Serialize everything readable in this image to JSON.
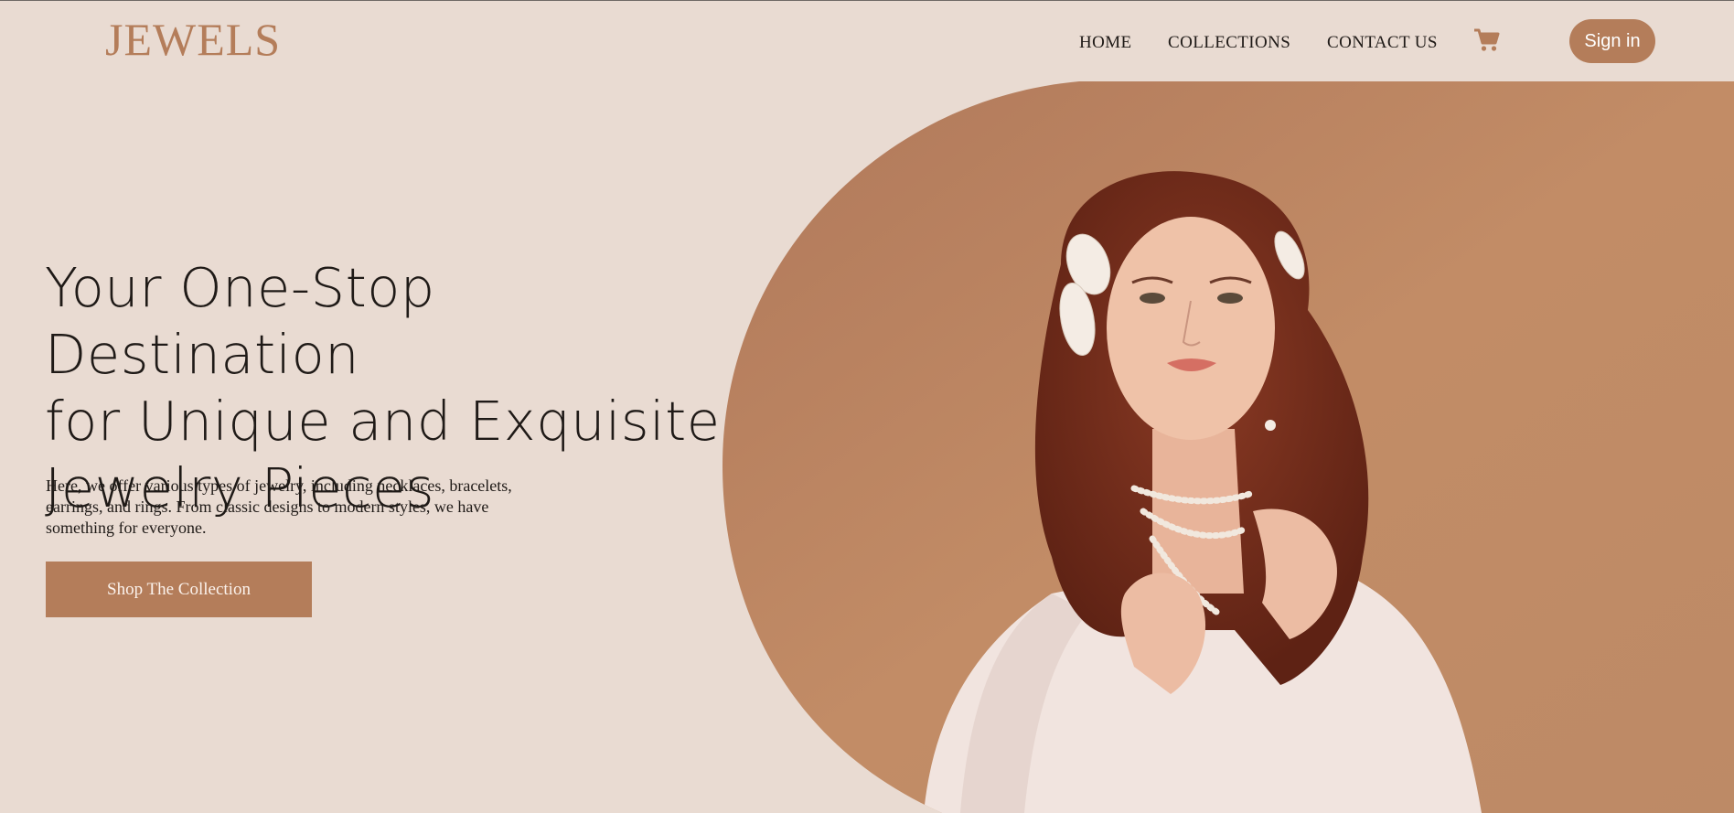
{
  "header": {
    "logo": "JEWELS",
    "nav": [
      "HOME",
      "COLLECTIONS",
      "CONTACT US"
    ],
    "cart_icon": "shopping-cart-icon",
    "signin_label": "Sign in"
  },
  "hero": {
    "title_lines": [
      "Your One-Stop Destination",
      "for Unique and Exquisite",
      "Jewelry Pieces"
    ],
    "description_lines": [
      "Here, we offer various types of jewelry, including necklaces, bracelets,",
      "earrings, and rings. From classic designs to modern styles, we have",
      "something for everyone."
    ],
    "cta_label": "Shop The Collection",
    "image": "woman-with-pearl-jewelry-photo"
  },
  "colors": {
    "background": "#e9dbd2",
    "accent": "#b47d5a",
    "text": "#1f1a17",
    "photo_backdrop": "#c08a62"
  }
}
